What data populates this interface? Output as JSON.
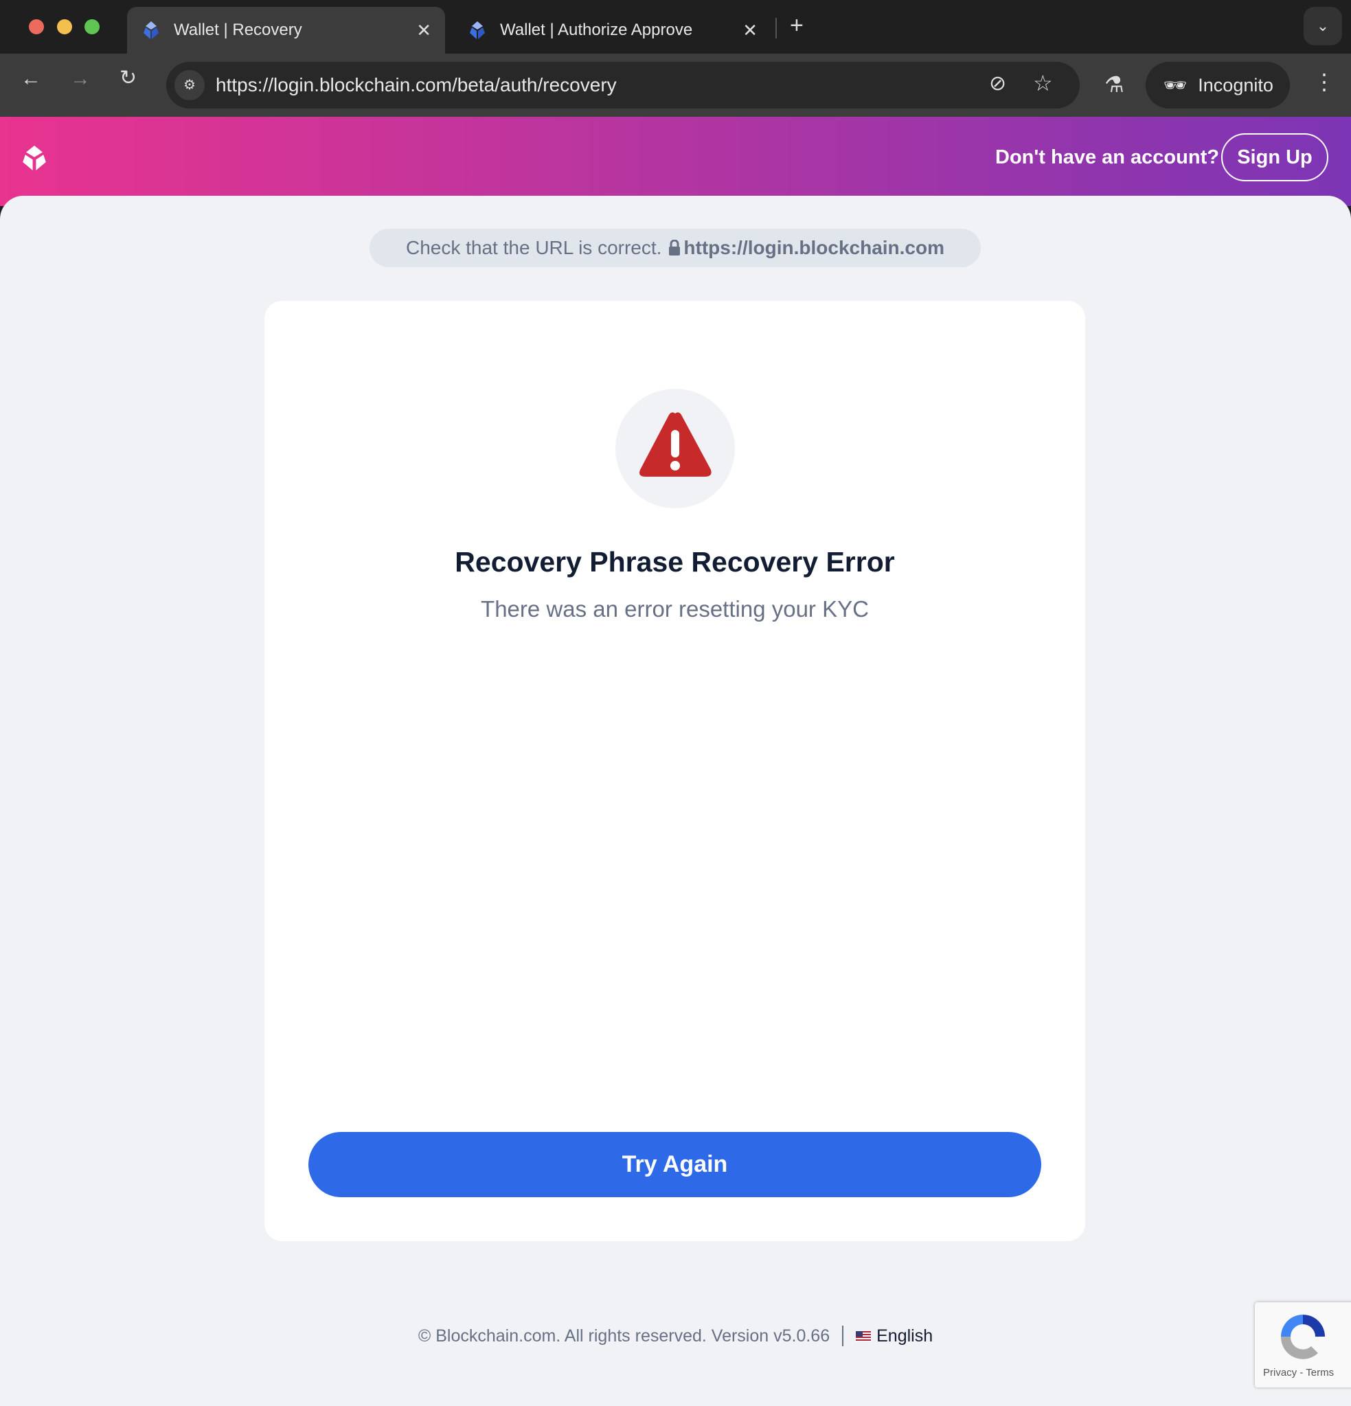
{
  "browser": {
    "tabs": [
      {
        "label": "Wallet | Recovery",
        "active": true
      },
      {
        "label": "Wallet | Authorize Approve",
        "active": false
      }
    ],
    "url": "https://login.blockchain.com/beta/auth/recovery",
    "incognito_label": "Incognito"
  },
  "header": {
    "prompt": "Don't have an account?",
    "signup_label": "Sign Up"
  },
  "url_check": {
    "text": "Check that the URL is correct.",
    "url": "https://login.blockchain.com"
  },
  "card": {
    "title": "Recovery Phrase Recovery Error",
    "subtitle": "There was an error resetting your KYC",
    "button_label": "Try Again",
    "icon": "warning-triangle-icon",
    "icon_color": "#c62a2a"
  },
  "footer": {
    "copyright": "© Blockchain.com. All rights reserved. Version v5.0.66",
    "language": "English"
  },
  "recaptcha": {
    "links": "Privacy - Terms"
  },
  "colors": {
    "accent": "#2e6ae8",
    "gradient_start": "#e8338f",
    "gradient_end": "#7c35b5"
  }
}
